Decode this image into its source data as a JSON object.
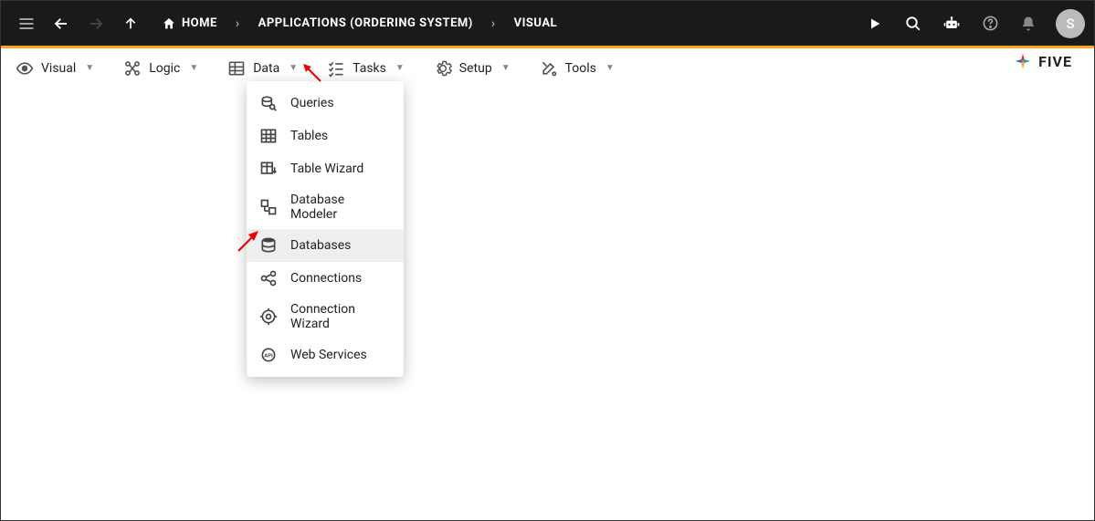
{
  "topbar": {
    "breadcrumb": [
      {
        "label": "HOME"
      },
      {
        "label": "APPLICATIONS (ORDERING SYSTEM)"
      },
      {
        "label": "VISUAL"
      }
    ],
    "avatar_initial": "S"
  },
  "logo": {
    "text": "FIVE"
  },
  "menubar": {
    "items": [
      {
        "label": "Visual"
      },
      {
        "label": "Logic"
      },
      {
        "label": "Data"
      },
      {
        "label": "Tasks"
      },
      {
        "label": "Setup"
      },
      {
        "label": "Tools"
      }
    ]
  },
  "dropdown": {
    "open_for": "Data",
    "items": [
      {
        "label": "Queries"
      },
      {
        "label": "Tables"
      },
      {
        "label": "Table Wizard"
      },
      {
        "label": "Database Modeler"
      },
      {
        "label": "Databases",
        "highlighted": true
      },
      {
        "label": "Connections"
      },
      {
        "label": "Connection Wizard"
      },
      {
        "label": "Web Services"
      }
    ]
  }
}
